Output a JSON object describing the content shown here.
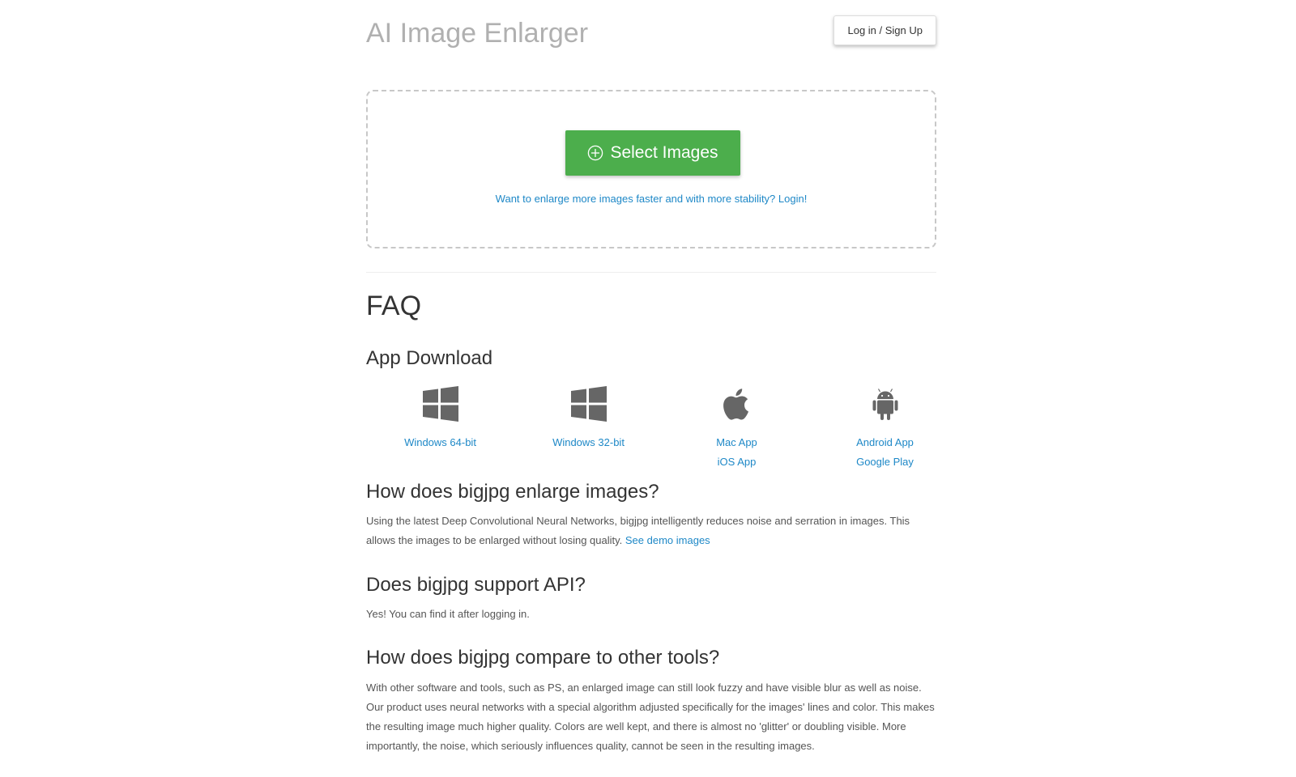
{
  "header": {
    "site_title": "AI Image Enlarger",
    "login_button": "Log in / Sign Up"
  },
  "upload": {
    "select_button": "Select Images",
    "select_icon": "plus-circle-icon",
    "login_hint": "Want to enlarge more images faster and with more stability? Login!"
  },
  "faq": {
    "title": "FAQ",
    "app_download": {
      "heading": "App Download",
      "apps": [
        {
          "icon": "windows-icon",
          "links": [
            "Windows 64-bit"
          ]
        },
        {
          "icon": "windows-icon",
          "links": [
            "Windows 32-bit"
          ]
        },
        {
          "icon": "apple-icon",
          "links": [
            "Mac App",
            "iOS App"
          ]
        },
        {
          "icon": "android-icon",
          "links": [
            "Android App",
            "Google Play"
          ]
        }
      ]
    },
    "q1": {
      "heading": "How does bigjpg enlarge images?",
      "body": "Using the latest Deep Convolutional Neural Networks, bigjpg intelligently reduces noise and serration in images. This allows the images to be enlarged without losing quality. ",
      "link": "See demo images"
    },
    "q2": {
      "heading": "Does bigjpg support API?",
      "body": "Yes! You can find it after logging in."
    },
    "q3": {
      "heading": "How does bigjpg compare to other tools?",
      "body": "With other software and tools, such as PS, an enlarged image can still look fuzzy and have visible blur as well as noise. Our product uses neural networks with a special algorithm adjusted specifically for the images' lines and color. This makes the resulting image much higher quality. Colors are well kept, and there is almost no 'glitter' or doubling visible. More importantly, the noise, which seriously influences quality, cannot be seen in the resulting images."
    }
  },
  "colors": {
    "accent_green": "#4cae4c",
    "link_blue": "#1e88c7",
    "title_gray": "#b0b0b0",
    "icon_gray": "#666666"
  }
}
